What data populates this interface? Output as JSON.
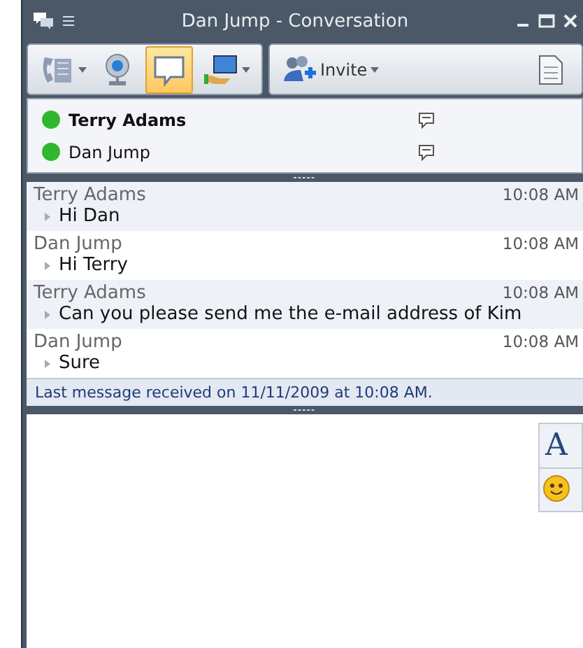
{
  "window": {
    "title": "Dan Jump - Conversation"
  },
  "toolbar": {
    "buttons": [
      {
        "kind": "phone",
        "selected": false,
        "dropdown": true
      },
      {
        "kind": "webcam",
        "selected": false,
        "dropdown": false
      },
      {
        "kind": "chat",
        "selected": true,
        "dropdown": false
      },
      {
        "kind": "share",
        "selected": false,
        "dropdown": true
      }
    ],
    "invite": {
      "label": "Invite"
    }
  },
  "participants": [
    {
      "name": "Terry Adams",
      "bold": true,
      "color": "#2fb82f"
    },
    {
      "name": "Dan Jump",
      "bold": false,
      "color": "#2fb82f"
    }
  ],
  "messages": [
    {
      "sender": "Terry Adams",
      "text": "Hi Dan",
      "time": "10:08 AM"
    },
    {
      "sender": "Dan Jump",
      "text": "Hi Terry",
      "time": "10:08 AM"
    },
    {
      "sender": "Terry Adams",
      "text": "Can you please send me the e-mail address of Kim",
      "time": "10:08 AM"
    },
    {
      "sender": "Dan Jump",
      "text": "Sure",
      "time": "10:08 AM"
    }
  ],
  "status_bar": {
    "text": "Last message received on 11/11/2009 at 10:08 AM."
  },
  "format_toolbar": {
    "font_label": "A"
  }
}
